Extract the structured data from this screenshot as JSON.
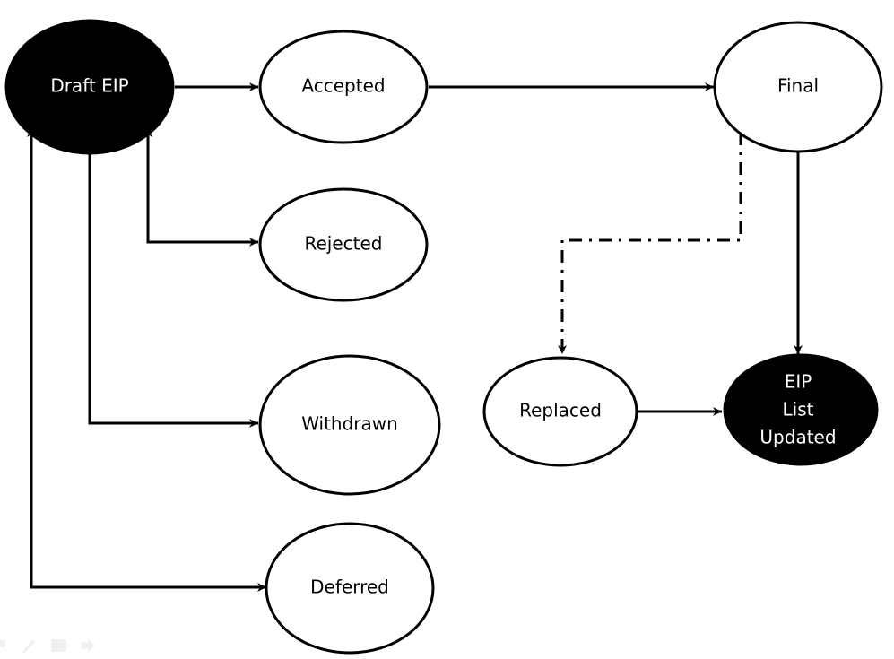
{
  "nodes": {
    "draft": {
      "label": "Draft EIP",
      "fill": "#000000",
      "text": "#ffffff"
    },
    "accepted": {
      "label": "Accepted",
      "fill": "#ffffff",
      "text": "#000000"
    },
    "final": {
      "label": "Final",
      "fill": "#ffffff",
      "text": "#000000"
    },
    "rejected": {
      "label": "Rejected",
      "fill": "#ffffff",
      "text": "#000000"
    },
    "withdrawn": {
      "label": "Withdrawn",
      "fill": "#ffffff",
      "text": "#000000"
    },
    "deferred": {
      "label": "Deferred",
      "fill": "#ffffff",
      "text": "#000000"
    },
    "replaced": {
      "label": "Replaced",
      "fill": "#ffffff",
      "text": "#000000"
    },
    "updated": {
      "lines": [
        "EIP",
        "List",
        "Updated"
      ],
      "fill": "#000000",
      "text": "#ffffff"
    }
  },
  "edges": [
    {
      "from": "Draft EIP",
      "to": "Accepted",
      "style": "solid"
    },
    {
      "from": "Accepted",
      "to": "Final",
      "style": "solid"
    },
    {
      "from": "Draft EIP",
      "to": "Rejected",
      "style": "solid",
      "bidirectional": true
    },
    {
      "from": "Draft EIP",
      "to": "Withdrawn",
      "style": "solid"
    },
    {
      "from": "Deferred",
      "to": "Draft EIP",
      "style": "solid",
      "bidirectional": true
    },
    {
      "from": "Final",
      "to": "EIP List Updated",
      "style": "solid"
    },
    {
      "from": "Final",
      "to": "Replaced",
      "style": "dash-dot"
    },
    {
      "from": "Replaced",
      "to": "EIP List Updated",
      "style": "solid"
    }
  ],
  "toolbar_icons": [
    "pointer-icon",
    "pen-icon",
    "menu-icon",
    "next-arrow-icon"
  ]
}
